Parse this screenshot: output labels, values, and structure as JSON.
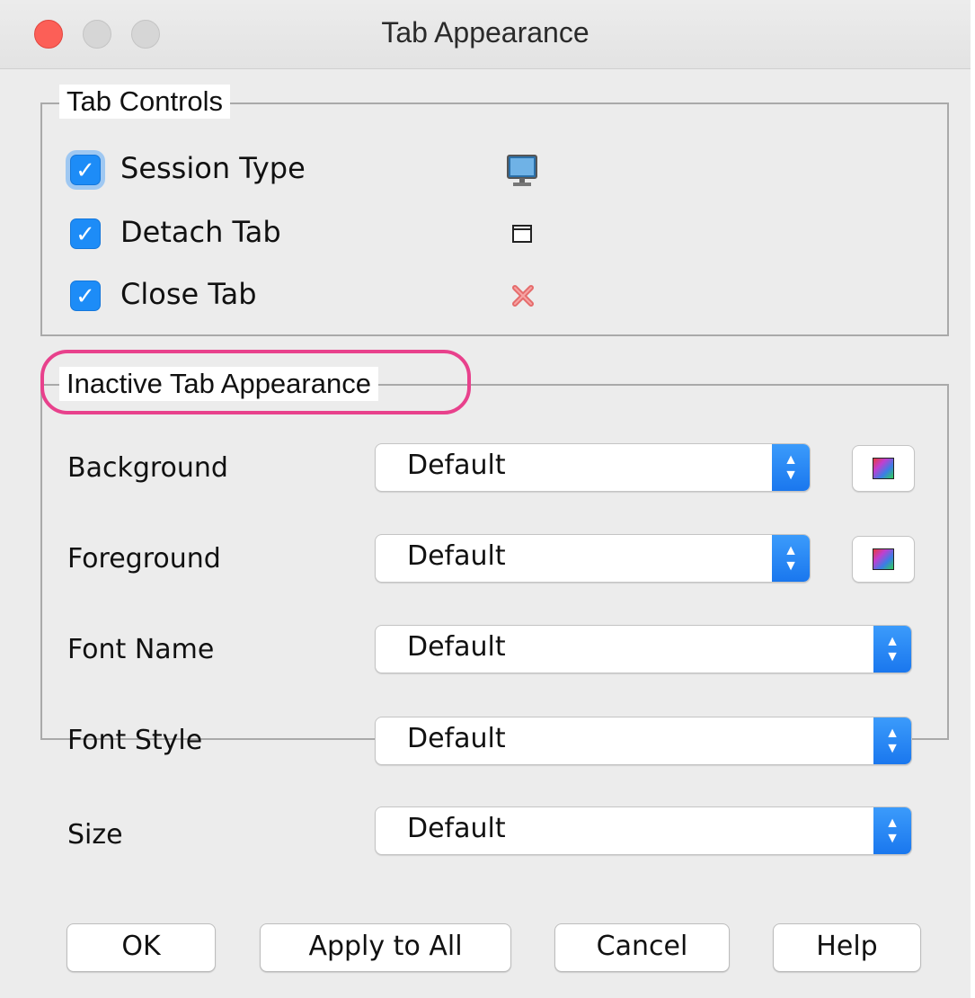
{
  "window": {
    "title": "Tab Appearance"
  },
  "tab_controls": {
    "legend": "Tab Controls",
    "items": [
      {
        "label": "Session Type",
        "checked": true,
        "icon": "monitor-icon"
      },
      {
        "label": "Detach Tab",
        "checked": true,
        "icon": "window-icon"
      },
      {
        "label": "Close Tab",
        "checked": true,
        "icon": "close-x-icon"
      }
    ]
  },
  "inactive_tab_appearance": {
    "legend": "Inactive Tab Appearance",
    "rows": [
      {
        "label": "Background",
        "value": "Default",
        "has_color_button": true
      },
      {
        "label": "Foreground",
        "value": "Default",
        "has_color_button": true
      },
      {
        "label": "Font Name",
        "value": "Default"
      },
      {
        "label": "Font Style",
        "value": "Default"
      },
      {
        "label": "Size",
        "value": "Default"
      }
    ]
  },
  "buttons": {
    "ok": "OK",
    "apply_all": "Apply to All",
    "cancel": "Cancel",
    "help": "Help"
  },
  "colors": {
    "accent": "#1d8cf7",
    "highlight": "#e8418c",
    "close_button": "#fc5f57"
  }
}
